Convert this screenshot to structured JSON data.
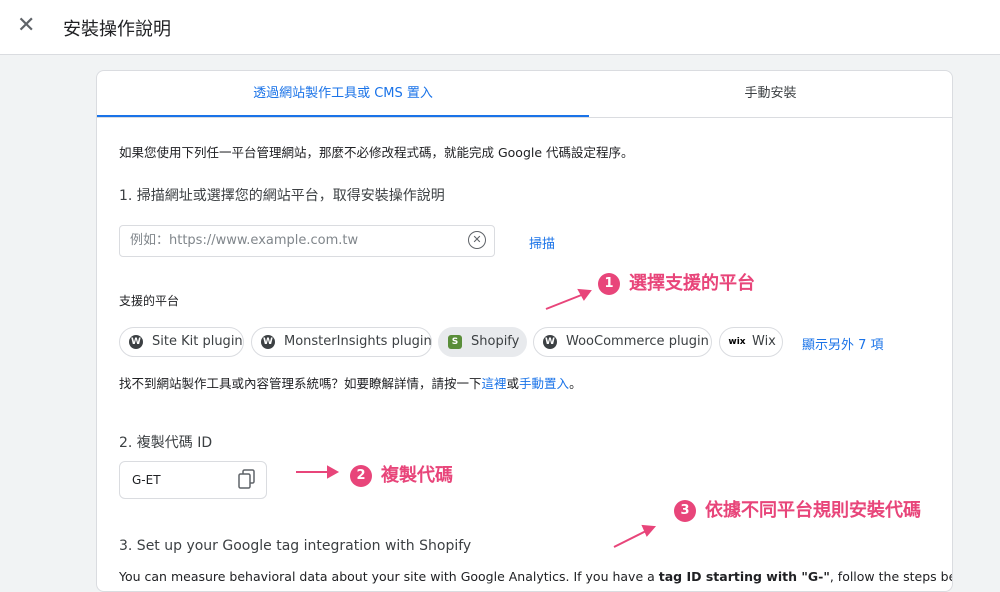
{
  "header": {
    "close_icon": "close-icon",
    "title": "安裝操作說明"
  },
  "tabs": [
    {
      "label": "透過網站製作工具或 CMS 置入",
      "active": true
    },
    {
      "label": "手動安裝",
      "active": false
    }
  ],
  "intro": "如果您使用下列任一平台管理網站，那麼不必修改程式碼，就能完成 Google 代碼設定程序。",
  "step1": {
    "heading": "1. 掃描網址或選擇您的網站平台，取得安裝操作說明",
    "input_placeholder": "例如：https://www.example.com.tw",
    "scan_label": "掃描"
  },
  "platforms": {
    "label": "支援的平台",
    "chips": [
      {
        "label": "Site Kit plugin",
        "icon": "wordpress-icon"
      },
      {
        "label": "MonsterInsights plugin",
        "icon": "wordpress-icon"
      },
      {
        "label": "Shopify",
        "icon": "shopify-icon",
        "selected": true
      },
      {
        "label": "WooCommerce plugin",
        "icon": "wordpress-icon"
      },
      {
        "label": "Wix",
        "icon": "wix-icon"
      }
    ],
    "more_label": "顯示另外 7 項",
    "help": {
      "prefix": "找不到網站製作工具或內容管理系統嗎？如要瞭解詳情，請按一下",
      "link1": "這裡",
      "or": "或",
      "link2": "手動置入",
      "suffix": "。"
    }
  },
  "step2": {
    "heading": "2. 複製代碼 ID",
    "tag_id": "G-ET"
  },
  "step3": {
    "heading": "3. Set up your Google tag integration with Shopify",
    "body_prefix": "You can measure behavioral data about your site with Google Analytics. If you have a ",
    "body_bold": "tag ID starting with \"G-\"",
    "body_suffix": ", follow the steps below"
  },
  "annotations": [
    {
      "num": "1",
      "text": "選擇支援的平台"
    },
    {
      "num": "2",
      "text": "複製代碼"
    },
    {
      "num": "3",
      "text": "依據不同平台規則安裝代碼"
    }
  ],
  "colors": {
    "accent": "#1a73e8",
    "annotation": "#e8457a"
  }
}
